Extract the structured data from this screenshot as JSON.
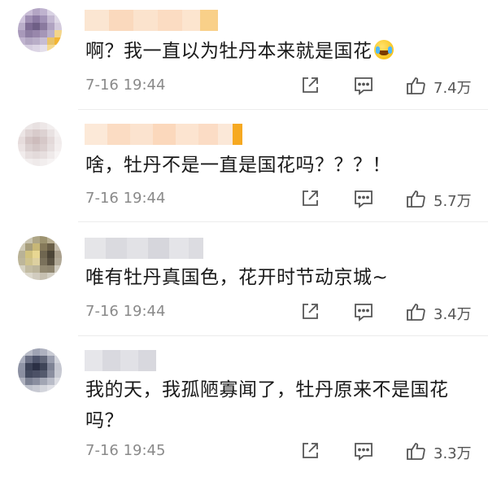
{
  "comments": [
    {
      "text": "啊？我一直以为牡丹本来就是国花",
      "emoji": "laugh-cry",
      "time": "7-16 19:44",
      "likes": "7.4万"
    },
    {
      "text": "啥，牡丹不是一直是国花吗？？？！",
      "time": "7-16 19:44",
      "likes": "5.7万"
    },
    {
      "text": "唯有牡丹真国色，花开时节动京城~",
      "time": "7-16 19:44",
      "likes": "3.4万"
    },
    {
      "text_line1": "我的天，我孤陋寡闻了，牡丹原来不是国花",
      "text_line2": "吗？",
      "time": "7-16 19:45",
      "likes": "3.3万"
    }
  ],
  "icons": {
    "share": "share-icon",
    "comment": "comment-icon",
    "like": "thumbs-up-icon"
  },
  "colors": {
    "meta_text": "#8a8a8a",
    "body_text": "#1a1a1a",
    "icon": "#555555"
  }
}
